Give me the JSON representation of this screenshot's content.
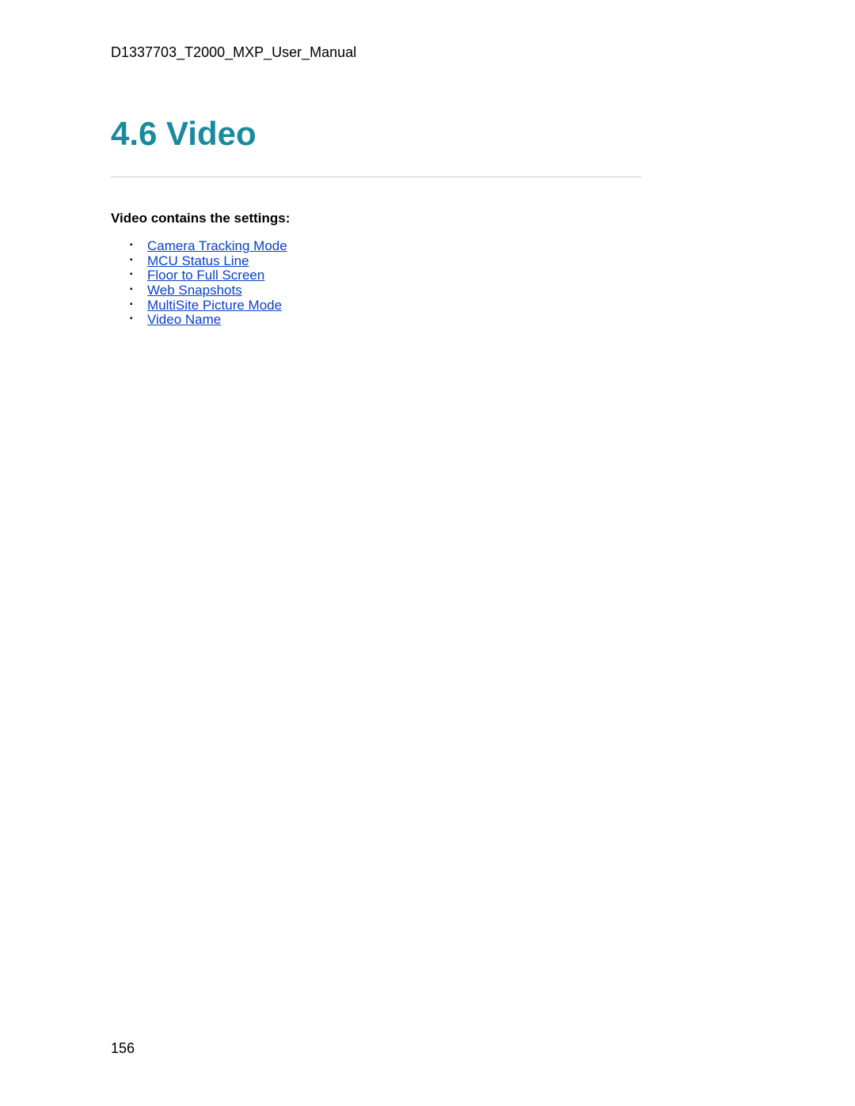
{
  "header": "D1337703_T2000_MXP_User_Manual",
  "heading": "4.6 Video",
  "subheading": "Video contains the settings:",
  "links": [
    "Camera Tracking Mode",
    "MCU Status Line",
    "Floor to Full Screen",
    "Web Snapshots",
    "MultiSite Picture Mode",
    "Video Name"
  ],
  "pageNumber": "156"
}
